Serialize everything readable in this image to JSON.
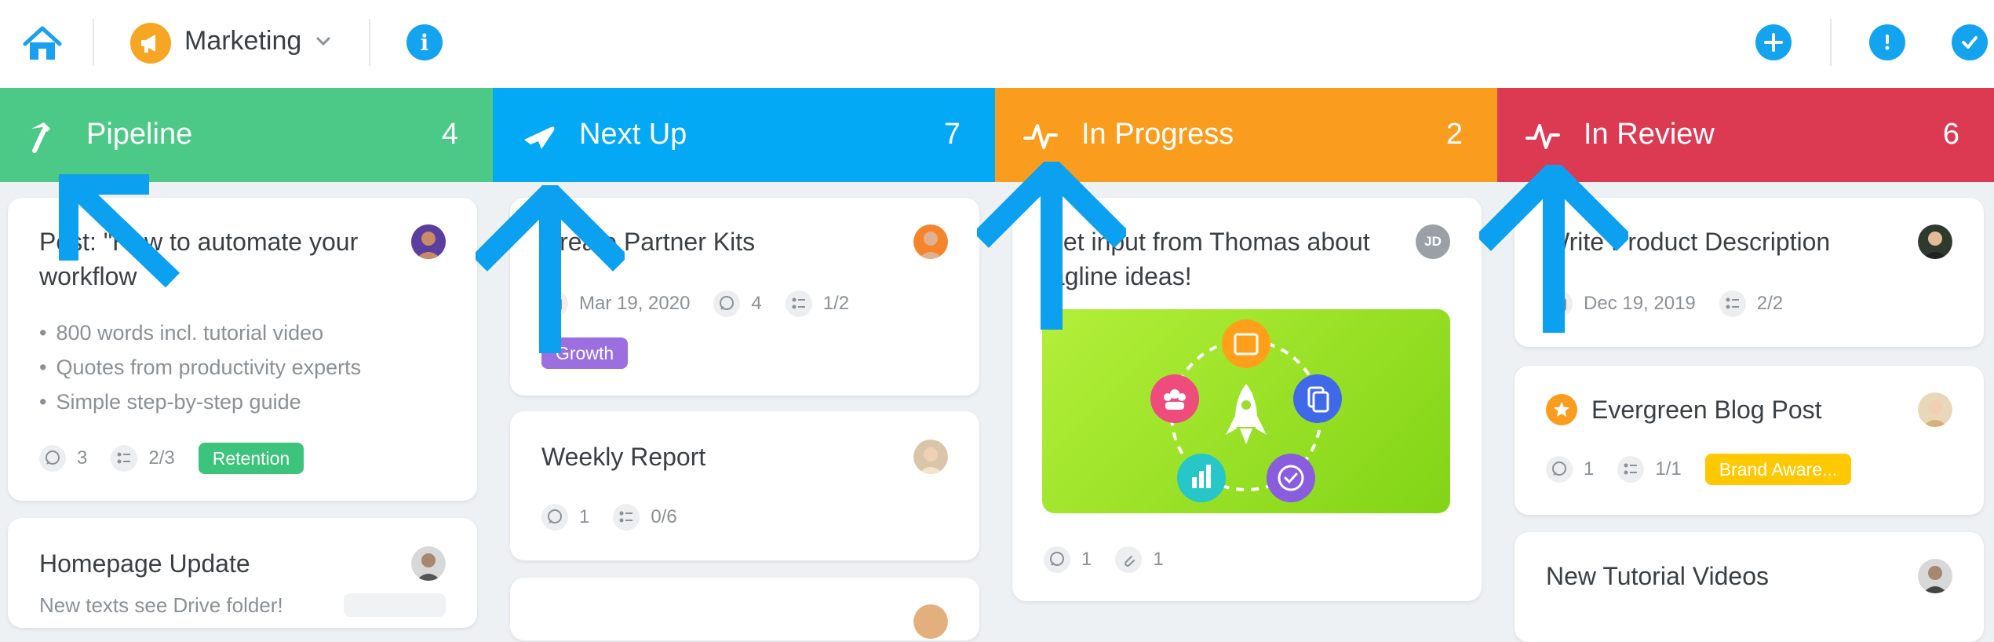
{
  "topbar": {
    "workspace_name": "Marketing",
    "info_label": "i"
  },
  "columns": [
    {
      "title": "Pipeline",
      "count": "4",
      "color": "#4cc987"
    },
    {
      "title": "Next Up",
      "count": "7",
      "color": "#04a9f5"
    },
    {
      "title": "In Progress",
      "count": "2",
      "color": "#fa9d1e"
    },
    {
      "title": "In Review",
      "count": "6",
      "color": "#dc3a53"
    }
  ],
  "pipeline": {
    "card1": {
      "title_line1": "Post: \"How to automate your",
      "title_line2": "workflow",
      "bullets": [
        "800 words incl. tutorial video",
        "Quotes from productivity experts",
        "Simple step-by-step guide"
      ],
      "comments": "3",
      "checklist": "2/3",
      "tag": "Retention",
      "tag_color": "#3cc47c"
    },
    "card2": {
      "title": "Homepage Update",
      "subtitle": "New texts see Drive folder!"
    }
  },
  "nextup": {
    "card1": {
      "title": "Create Partner Kits",
      "date": "Mar 19, 2020",
      "comments": "4",
      "checklist": "1/2",
      "tag": "Growth",
      "tag_color": "#9b6fdf"
    },
    "card2": {
      "title": "Weekly Report",
      "comments": "1",
      "checklist": "0/6"
    }
  },
  "inprogress": {
    "card1": {
      "title_line1": "Get input from Thomas about",
      "title_line2": "tagline ideas!",
      "avatar_initials": "JD",
      "comments": "1",
      "attachments": "1"
    }
  },
  "inreview": {
    "card1": {
      "title": "Write Product Description",
      "date": "Dec 19, 2019",
      "checklist": "2/2"
    },
    "card2": {
      "title": "Evergreen Blog Post",
      "comments": "1",
      "checklist": "1/1",
      "tag": "Brand Aware...",
      "tag_color": "#ffc800"
    },
    "card3": {
      "title": "New Tutorial Videos"
    }
  },
  "colors": {
    "accent": "#13a3ef",
    "arrow": "#0ba0f0"
  }
}
